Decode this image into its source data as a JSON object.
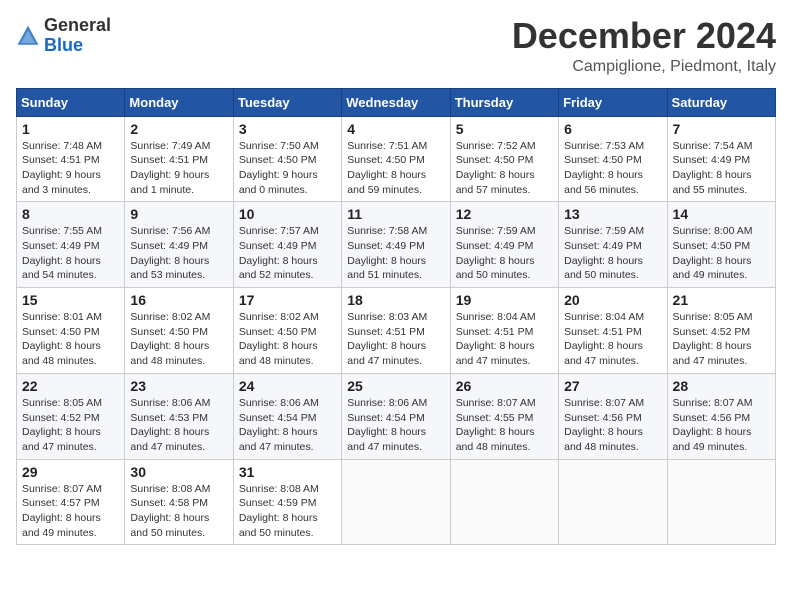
{
  "header": {
    "logo_general": "General",
    "logo_blue": "Blue",
    "month_title": "December 2024",
    "location": "Campiglione, Piedmont, Italy"
  },
  "weekdays": [
    "Sunday",
    "Monday",
    "Tuesday",
    "Wednesday",
    "Thursday",
    "Friday",
    "Saturday"
  ],
  "weeks": [
    [
      {
        "day": "1",
        "sunrise": "7:48 AM",
        "sunset": "4:51 PM",
        "daylight": "9 hours and 3 minutes."
      },
      {
        "day": "2",
        "sunrise": "7:49 AM",
        "sunset": "4:51 PM",
        "daylight": "9 hours and 1 minute."
      },
      {
        "day": "3",
        "sunrise": "7:50 AM",
        "sunset": "4:50 PM",
        "daylight": "9 hours and 0 minutes."
      },
      {
        "day": "4",
        "sunrise": "7:51 AM",
        "sunset": "4:50 PM",
        "daylight": "8 hours and 59 minutes."
      },
      {
        "day": "5",
        "sunrise": "7:52 AM",
        "sunset": "4:50 PM",
        "daylight": "8 hours and 57 minutes."
      },
      {
        "day": "6",
        "sunrise": "7:53 AM",
        "sunset": "4:50 PM",
        "daylight": "8 hours and 56 minutes."
      },
      {
        "day": "7",
        "sunrise": "7:54 AM",
        "sunset": "4:49 PM",
        "daylight": "8 hours and 55 minutes."
      }
    ],
    [
      {
        "day": "8",
        "sunrise": "7:55 AM",
        "sunset": "4:49 PM",
        "daylight": "8 hours and 54 minutes."
      },
      {
        "day": "9",
        "sunrise": "7:56 AM",
        "sunset": "4:49 PM",
        "daylight": "8 hours and 53 minutes."
      },
      {
        "day": "10",
        "sunrise": "7:57 AM",
        "sunset": "4:49 PM",
        "daylight": "8 hours and 52 minutes."
      },
      {
        "day": "11",
        "sunrise": "7:58 AM",
        "sunset": "4:49 PM",
        "daylight": "8 hours and 51 minutes."
      },
      {
        "day": "12",
        "sunrise": "7:59 AM",
        "sunset": "4:49 PM",
        "daylight": "8 hours and 50 minutes."
      },
      {
        "day": "13",
        "sunrise": "7:59 AM",
        "sunset": "4:49 PM",
        "daylight": "8 hours and 50 minutes."
      },
      {
        "day": "14",
        "sunrise": "8:00 AM",
        "sunset": "4:50 PM",
        "daylight": "8 hours and 49 minutes."
      }
    ],
    [
      {
        "day": "15",
        "sunrise": "8:01 AM",
        "sunset": "4:50 PM",
        "daylight": "8 hours and 48 minutes."
      },
      {
        "day": "16",
        "sunrise": "8:02 AM",
        "sunset": "4:50 PM",
        "daylight": "8 hours and 48 minutes."
      },
      {
        "day": "17",
        "sunrise": "8:02 AM",
        "sunset": "4:50 PM",
        "daylight": "8 hours and 48 minutes."
      },
      {
        "day": "18",
        "sunrise": "8:03 AM",
        "sunset": "4:51 PM",
        "daylight": "8 hours and 47 minutes."
      },
      {
        "day": "19",
        "sunrise": "8:04 AM",
        "sunset": "4:51 PM",
        "daylight": "8 hours and 47 minutes."
      },
      {
        "day": "20",
        "sunrise": "8:04 AM",
        "sunset": "4:51 PM",
        "daylight": "8 hours and 47 minutes."
      },
      {
        "day": "21",
        "sunrise": "8:05 AM",
        "sunset": "4:52 PM",
        "daylight": "8 hours and 47 minutes."
      }
    ],
    [
      {
        "day": "22",
        "sunrise": "8:05 AM",
        "sunset": "4:52 PM",
        "daylight": "8 hours and 47 minutes."
      },
      {
        "day": "23",
        "sunrise": "8:06 AM",
        "sunset": "4:53 PM",
        "daylight": "8 hours and 47 minutes."
      },
      {
        "day": "24",
        "sunrise": "8:06 AM",
        "sunset": "4:54 PM",
        "daylight": "8 hours and 47 minutes."
      },
      {
        "day": "25",
        "sunrise": "8:06 AM",
        "sunset": "4:54 PM",
        "daylight": "8 hours and 47 minutes."
      },
      {
        "day": "26",
        "sunrise": "8:07 AM",
        "sunset": "4:55 PM",
        "daylight": "8 hours and 48 minutes."
      },
      {
        "day": "27",
        "sunrise": "8:07 AM",
        "sunset": "4:56 PM",
        "daylight": "8 hours and 48 minutes."
      },
      {
        "day": "28",
        "sunrise": "8:07 AM",
        "sunset": "4:56 PM",
        "daylight": "8 hours and 49 minutes."
      }
    ],
    [
      {
        "day": "29",
        "sunrise": "8:07 AM",
        "sunset": "4:57 PM",
        "daylight": "8 hours and 49 minutes."
      },
      {
        "day": "30",
        "sunrise": "8:08 AM",
        "sunset": "4:58 PM",
        "daylight": "8 hours and 50 minutes."
      },
      {
        "day": "31",
        "sunrise": "8:08 AM",
        "sunset": "4:59 PM",
        "daylight": "8 hours and 50 minutes."
      },
      null,
      null,
      null,
      null
    ]
  ]
}
